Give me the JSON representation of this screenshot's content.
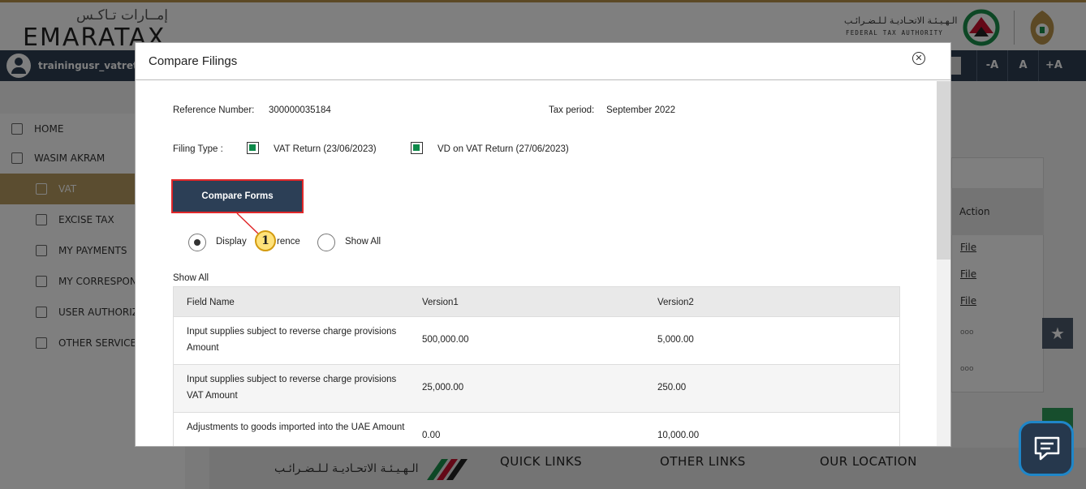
{
  "brand": {
    "logo_ar": "إمــارات تـاكـس",
    "logo_en": "EMARATAX",
    "fta_ar": "الـهـيـئـة الاتحـاديـة لـلـضـرائـب",
    "fta_en": "FEDERAL TAX AUTHORITY"
  },
  "userbar": {
    "username": "trainingusr_vatretu",
    "font_buttons": [
      "-A",
      "A",
      "+A"
    ]
  },
  "sidebar": {
    "items": [
      {
        "label": "HOME",
        "icon": "home-icon"
      },
      {
        "label": "WASIM AKRAM",
        "icon": "grid-icon"
      },
      {
        "label": "VAT",
        "icon": "coins-icon"
      },
      {
        "label": "EXCISE TAX",
        "icon": "document-icon"
      },
      {
        "label": "MY PAYMENTS",
        "icon": "card-icon"
      },
      {
        "label": "MY CORRESPON",
        "icon": "bank-icon"
      },
      {
        "label": "USER AUTHORIZ",
        "icon": "user-icon"
      },
      {
        "label": "OTHER SERVICE",
        "icon": "clipboard-icon"
      }
    ]
  },
  "bg_table": {
    "action_header": "Action",
    "file_links": [
      "File",
      "File",
      "File"
    ],
    "more": [
      "ooo",
      "ooo"
    ]
  },
  "footer": {
    "fta_ar": "الـهـيـئـة الاتحـاديـة لـلـضـرائـب",
    "quick_links": "QUICK LINKS",
    "other_links": "OTHER LINKS",
    "our_location": "OUR LOCATION"
  },
  "modal": {
    "title": "Compare Filings",
    "reference_label": "Reference Number:",
    "reference_value": "300000035184",
    "tax_period_label": "Tax period:",
    "tax_period_value": "September 2022",
    "filing_type_label": "Filing Type :",
    "filing_options": [
      {
        "label": "VAT Return (23/06/2023)",
        "checked": true
      },
      {
        "label": "VD on VAT Return (27/06/2023)",
        "checked": true
      }
    ],
    "compare_button": "Compare Forms",
    "callout_number": "1",
    "radio_display_difference": "Display Difference",
    "radio_display_difference_visible_left": "Display",
    "radio_display_difference_visible_right": "rence",
    "radio_show_all": "Show All",
    "selected_radio": "Display Difference",
    "section_title": "Show All",
    "table": {
      "headers": [
        "Field Name",
        "Version1",
        "Version2"
      ],
      "rows": [
        {
          "field": "Input supplies subject to reverse charge provisions Amount",
          "v1": "500,000.00",
          "v2": "5,000.00"
        },
        {
          "field": "Input supplies subject to reverse charge provisions VAT Amount",
          "v1": "25,000.00",
          "v2": "250.00"
        },
        {
          "field": "Adjustments to goods imported into the UAE Amount",
          "v1": "0.00",
          "v2": "10,000.00"
        }
      ]
    }
  },
  "colors": {
    "primary_navy": "#2c3f56",
    "highlight_red": "#e0282a",
    "check_green": "#0e8a4a",
    "sidebar_active": "#b79a60",
    "callout_yellow": "#ffe27a"
  }
}
